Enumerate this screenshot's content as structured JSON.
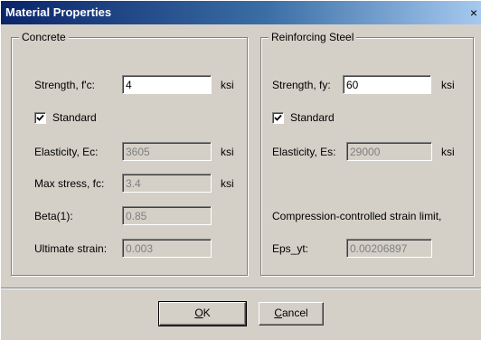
{
  "dialog": {
    "title": "Material Properties",
    "close_glyph": "×"
  },
  "concrete": {
    "group_title": "Concrete",
    "strength_label": "Strength, f'c:",
    "strength_value": "4",
    "strength_unit": "ksi",
    "standard_label": "Standard",
    "standard_checked": true,
    "elasticity_label": "Elasticity, Ec:",
    "elasticity_value": "3605",
    "elasticity_unit": "ksi",
    "max_stress_label": "Max stress, fc:",
    "max_stress_value": "3.4",
    "max_stress_unit": "ksi",
    "beta_label": "Beta(1):",
    "beta_value": "0.85",
    "ultimate_strain_label": "Ultimate strain:",
    "ultimate_strain_value": "0.003"
  },
  "steel": {
    "group_title": "Reinforcing Steel",
    "strength_label": "Strength, fy:",
    "strength_value": "60",
    "strength_unit": "ksi",
    "standard_label": "Standard",
    "standard_checked": true,
    "elasticity_label": "Elasticity, Es:",
    "elasticity_value": "29000",
    "elasticity_unit": "ksi",
    "compression_limit_label": "Compression-controlled strain limit,",
    "eps_label": "Eps_yt:",
    "eps_value": "0.00206897"
  },
  "buttons": {
    "ok_mnemonic": "O",
    "ok_rest": "K",
    "cancel_mnemonic": "C",
    "cancel_rest": "ancel"
  }
}
